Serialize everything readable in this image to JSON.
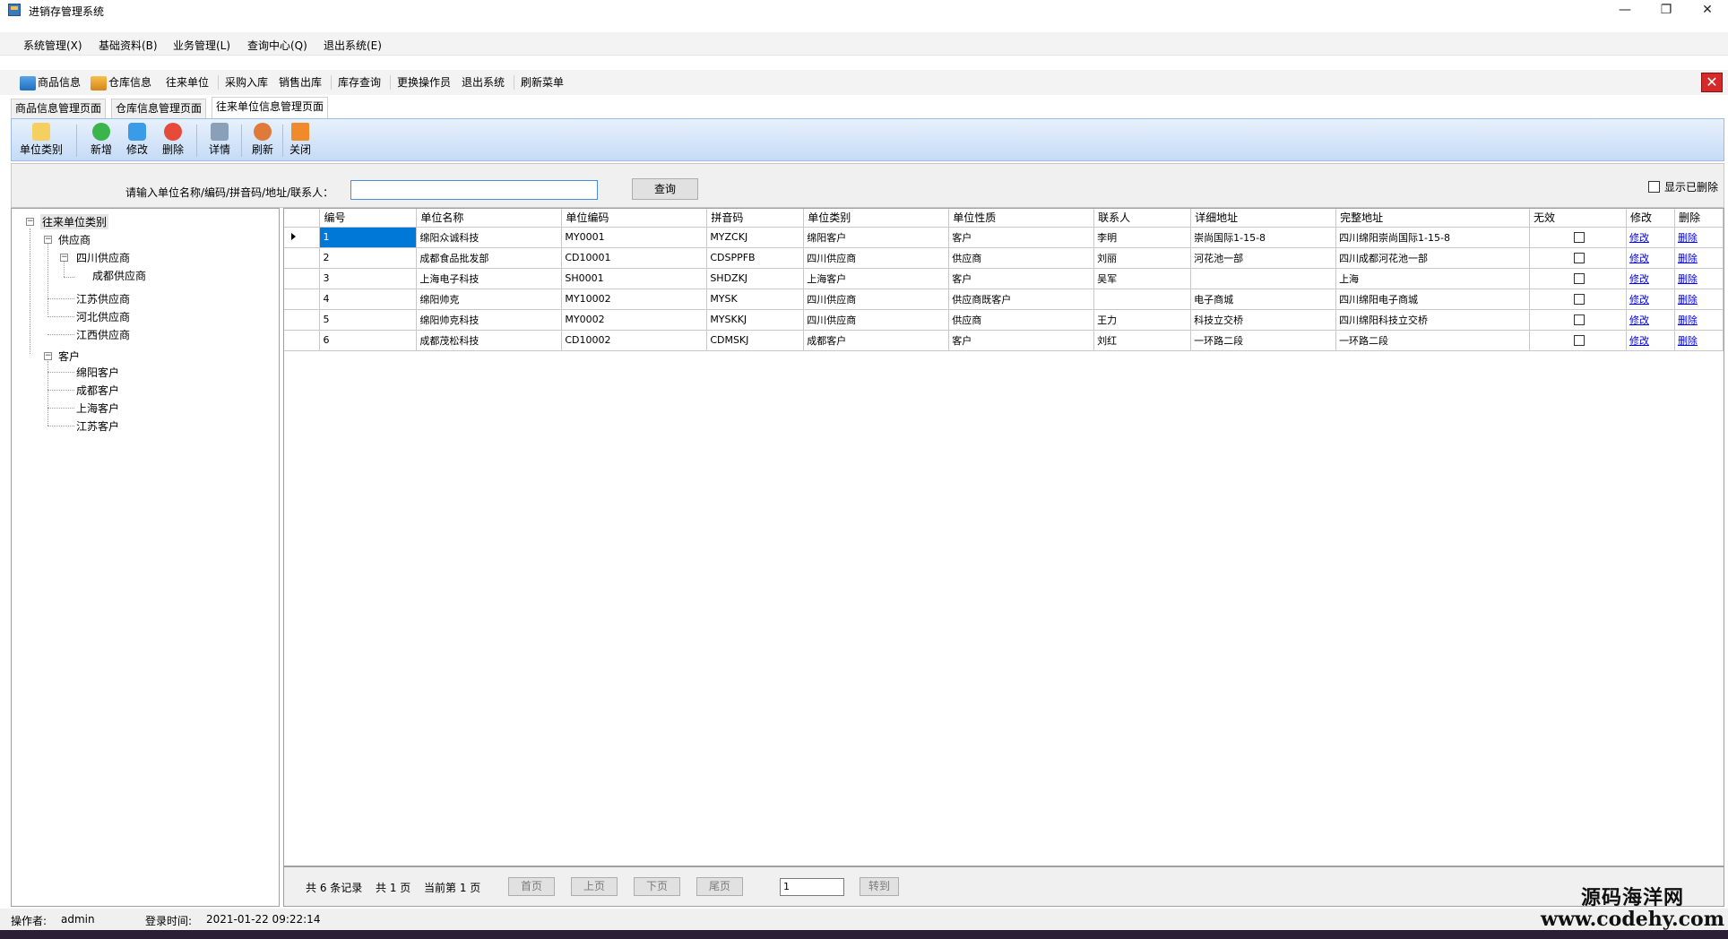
{
  "window": {
    "title": "进销存管理系统",
    "min_glyph": "—",
    "max_glyph": "❐",
    "close_glyph": "✕"
  },
  "menu": [
    "系统管理(X)",
    "基础资料(B)",
    "业务管理(L)",
    "查询中心(Q)",
    "退出系统(E)"
  ],
  "toolbar": {
    "items": [
      "商品信息",
      "仓库信息",
      "往来单位",
      "采购入库",
      "销售出库",
      "库存查询",
      "更换操作员",
      "退出系统",
      "刷新菜单"
    ],
    "close_glyph": "✕"
  },
  "tabs": [
    "商品信息管理页面",
    "仓库信息管理页面",
    "往来单位信息管理页面"
  ],
  "actions": [
    "单位类别",
    "新增",
    "修改",
    "删除",
    "详情",
    "刷新",
    "关闭"
  ],
  "search": {
    "label": "请输入单位名称/编码/拼音码/地址/联系人：",
    "value": "",
    "button": "查询",
    "show_deleted": "显示已删除"
  },
  "tree": {
    "root": "往来单位类别",
    "suppliers": "供应商",
    "sichuan": "四川供应商",
    "chengdu_sup": "成都供应商",
    "jiangsu": "江苏供应商",
    "hebei": "河北供应商",
    "jiangxi": "江西供应商",
    "customers": "客户",
    "mianyang": "绵阳客户",
    "chengdu_cus": "成都客户",
    "shanghai": "上海客户",
    "jiangsu_cus": "江苏客户",
    "expand_glyph": "−"
  },
  "grid": {
    "columns": [
      "编号",
      "单位名称",
      "单位编码",
      "拼音码",
      "单位类别",
      "单位性质",
      "联系人",
      "详细地址",
      "完整地址",
      "无效",
      "修改",
      "删除"
    ],
    "edit_link": "修改",
    "delete_link": "删除",
    "rows": [
      {
        "id": "1",
        "name": "绵阳众诚科技",
        "code": "MY0001",
        "py": "MYZCKJ",
        "cat": "绵阳客户",
        "type": "客户",
        "contact": "李明",
        "addr": "崇尚国际1-15-8",
        "full": "四川绵阳崇尚国际1-15-8",
        "invalid": false
      },
      {
        "id": "2",
        "name": "成都食品批发部",
        "code": "CD10001",
        "py": "CDSPPFB",
        "cat": "四川供应商",
        "type": "供应商",
        "contact": "刘丽",
        "addr": "河花池一部",
        "full": "四川成都河花池一部",
        "invalid": false
      },
      {
        "id": "3",
        "name": "上海电子科技",
        "code": "SH0001",
        "py": "SHDZKJ",
        "cat": "上海客户",
        "type": "客户",
        "contact": "吴军",
        "addr": "",
        "full": "上海",
        "invalid": false
      },
      {
        "id": "4",
        "name": "绵阳帅克",
        "code": "MY10002",
        "py": "MYSK",
        "cat": "四川供应商",
        "type": "供应商既客户",
        "contact": "",
        "addr": "电子商城",
        "full": "四川绵阳电子商城",
        "invalid": false
      },
      {
        "id": "5",
        "name": "绵阳帅克科技",
        "code": "MY0002",
        "py": "MYSKKJ",
        "cat": "四川供应商",
        "type": "供应商",
        "contact": "王力",
        "addr": "科技立交桥",
        "full": "四川绵阳科技立交桥",
        "invalid": false
      },
      {
        "id": "6",
        "name": "成都茂松科技",
        "code": "CD10002",
        "py": "CDMSKJ",
        "cat": "成都客户",
        "type": "客户",
        "contact": "刘红",
        "addr": "一环路二段",
        "full": "一环路二段",
        "invalid": false
      }
    ]
  },
  "pager": {
    "total_records": "共 6 条记录",
    "total_pages": "共 1 页",
    "current_page": "当前第 1 页",
    "first": "首页",
    "prev": "上页",
    "next": "下页",
    "last": "尾页",
    "page_input": "1",
    "goto": "转到"
  },
  "status": {
    "operator_label": "操作者:",
    "operator": "admin",
    "login_label": "登录时间:",
    "login_time": "2021-01-22 09:22:14"
  },
  "watermark": {
    "line1": "源码海洋网",
    "line2": "www.codehy.com"
  },
  "colors": {
    "accent": "#0078d7",
    "toolbar_gradient_top": "#e8f1fc",
    "toolbar_gradient_bottom": "#c5dbf6"
  }
}
